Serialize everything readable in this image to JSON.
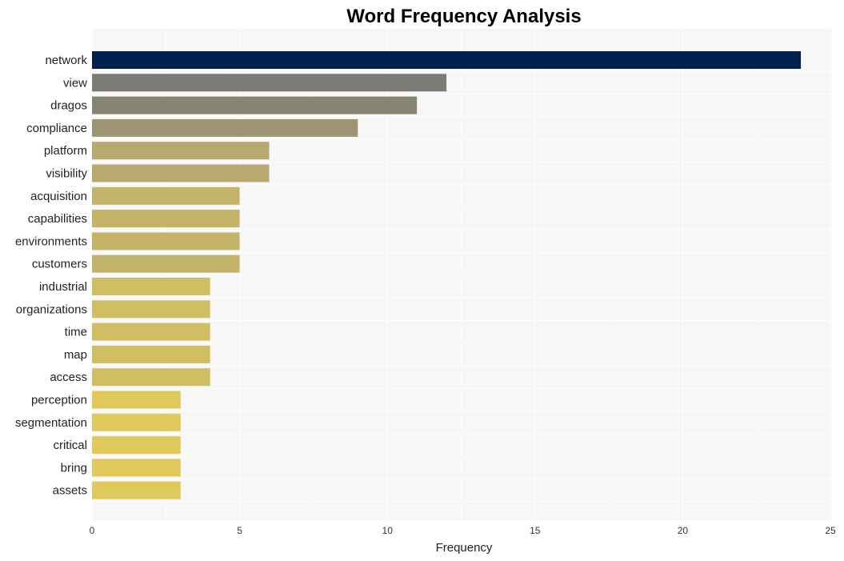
{
  "chart_data": {
    "type": "bar",
    "orientation": "horizontal",
    "title": "Word Frequency Analysis",
    "xlabel": "Frequency",
    "ylabel": "",
    "xlim": [
      0,
      25
    ],
    "xticks": [
      0,
      5,
      10,
      15,
      20,
      25
    ],
    "grid": true,
    "legend": "none",
    "categories": [
      "network",
      "view",
      "dragos",
      "compliance",
      "platform",
      "visibility",
      "acquisition",
      "capabilities",
      "environments",
      "customers",
      "industrial",
      "organizations",
      "time",
      "map",
      "access",
      "perception",
      "segmentation",
      "critical",
      "bring",
      "assets"
    ],
    "values": [
      24,
      12,
      11,
      9,
      6,
      6,
      5,
      5,
      5,
      5,
      4,
      4,
      4,
      4,
      4,
      3,
      3,
      3,
      3,
      3
    ],
    "colors": [
      "#00204e",
      "#7c7b78",
      "#878472",
      "#9c9574",
      "#b8a96f",
      "#b8a96f",
      "#c4b46a",
      "#c4b46a",
      "#c4b46a",
      "#c4b46a",
      "#d0bf62",
      "#d0bf62",
      "#d0bf62",
      "#d0bf62",
      "#d0bf62",
      "#dfc95a",
      "#dfc95a",
      "#dfc95a",
      "#dfc95a",
      "#dfc95a"
    ]
  }
}
